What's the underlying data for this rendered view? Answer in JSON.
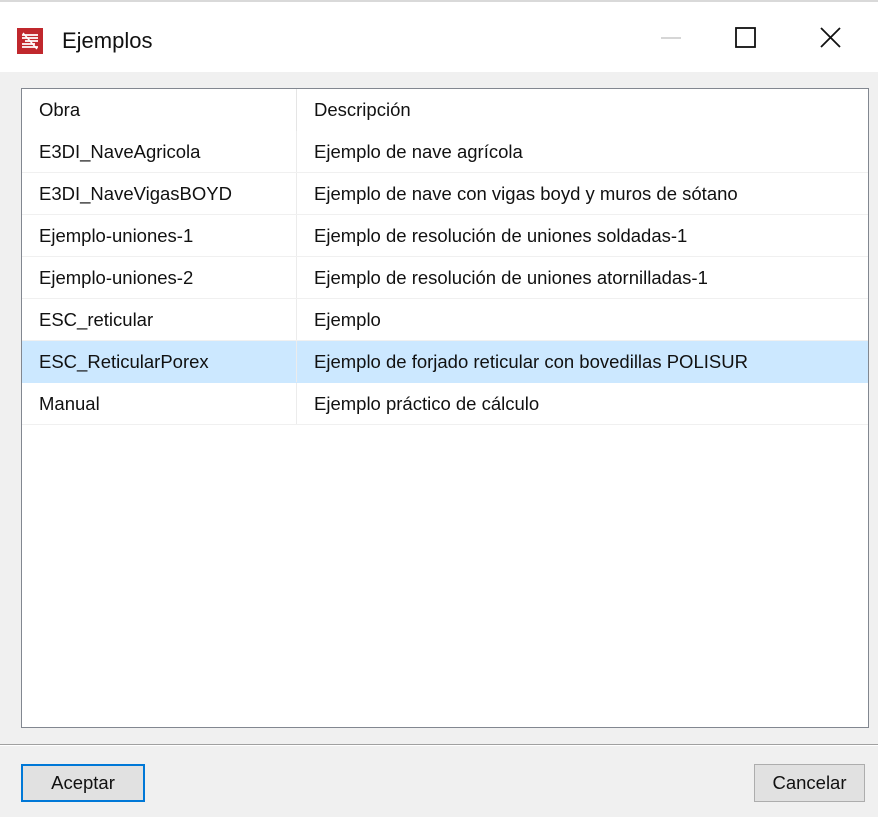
{
  "window": {
    "title": "Ejemplos",
    "icon": "app-logo-icon",
    "controls": {
      "minimize": "minimize-icon",
      "maximize": "maximize-icon",
      "close": "close-icon"
    }
  },
  "list": {
    "columns": [
      "Obra",
      "Descripción"
    ],
    "rows": [
      {
        "obra": "E3DI_NaveAgricola",
        "descripcion": "Ejemplo de nave agrícola"
      },
      {
        "obra": "E3DI_NaveVigasBOYD",
        "descripcion": "Ejemplo de nave con vigas boyd y muros de sótano"
      },
      {
        "obra": "Ejemplo-uniones-1",
        "descripcion": "Ejemplo de resolución de uniones soldadas-1"
      },
      {
        "obra": "Ejemplo-uniones-2",
        "descripcion": "Ejemplo de resolución de uniones atornilladas-1"
      },
      {
        "obra": "ESC_reticular",
        "descripcion": "Ejemplo"
      },
      {
        "obra": "ESC_ReticularPorex",
        "descripcion": "Ejemplo de forjado reticular con bovedillas POLISUR"
      },
      {
        "obra": "Manual",
        "descripcion": "Ejemplo práctico de cálculo"
      }
    ],
    "selected_index": 5
  },
  "buttons": {
    "accept": "Aceptar",
    "cancel": "Cancelar"
  },
  "colors": {
    "selection": "#cce8ff",
    "default_button_border": "#0078d7",
    "app_icon": "#c0282d"
  }
}
